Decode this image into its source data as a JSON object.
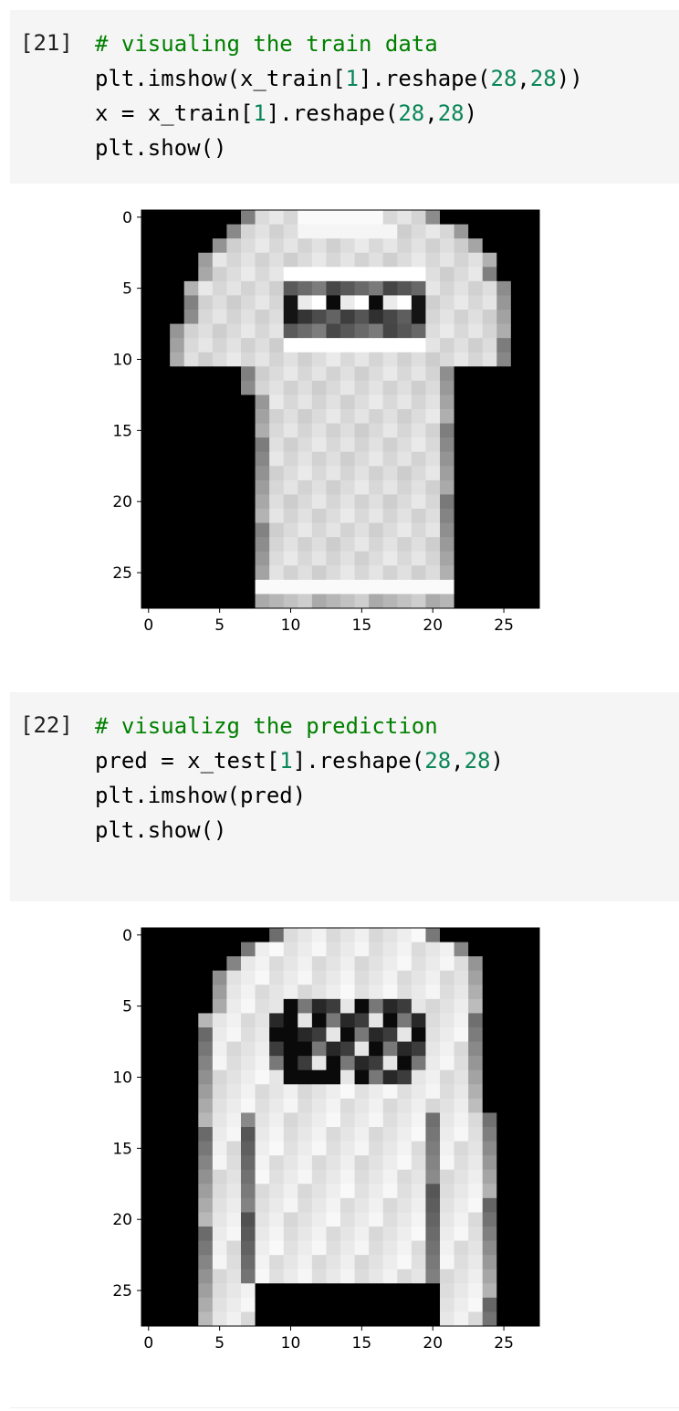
{
  "colors": {
    "cell_bg": "#f5f5f5",
    "comment": "#008000",
    "number": "#098658"
  },
  "cells": [
    {
      "exec_count": "[21]",
      "lines": [
        [
          {
            "t": "# visualing the train data",
            "c": "comment"
          }
        ],
        [
          {
            "t": "plt.imshow(x_train["
          },
          {
            "t": "1",
            "c": "num"
          },
          {
            "t": "].reshape("
          },
          {
            "t": "28",
            "c": "num"
          },
          {
            "t": ","
          },
          {
            "t": "28",
            "c": "num"
          },
          {
            "t": "))"
          }
        ],
        [
          {
            "t": "x = x_train["
          },
          {
            "t": "1",
            "c": "num"
          },
          {
            "t": "].reshape("
          },
          {
            "t": "28",
            "c": "num"
          },
          {
            "t": ","
          },
          {
            "t": "28",
            "c": "num"
          },
          {
            "t": ")"
          }
        ],
        [
          {
            "t": "plt.show()"
          }
        ]
      ]
    },
    {
      "exec_count": "[22]",
      "lines": [
        [
          {
            "t": "# visualizg the prediction",
            "c": "comment"
          }
        ],
        [
          {
            "t": "pred = x_test["
          },
          {
            "t": "1",
            "c": "num"
          },
          {
            "t": "].reshape("
          },
          {
            "t": "28",
            "c": "num"
          },
          {
            "t": ","
          },
          {
            "t": "28",
            "c": "num"
          },
          {
            "t": ")"
          }
        ],
        [
          {
            "t": "plt.imshow(pred)"
          }
        ],
        [
          {
            "t": "plt.show()"
          }
        ]
      ]
    }
  ],
  "chart_data": [
    {
      "type": "heatmap",
      "colormap": "gray",
      "rows": 28,
      "cols": 28,
      "xticks": [
        0,
        5,
        10,
        15,
        20,
        25
      ],
      "yticks": [
        0,
        5,
        10,
        15,
        20,
        25
      ],
      "description_shape": "tshirt",
      "shape_params": {
        "neck_rows": [
          0,
          1
        ],
        "neck_cols": [
          11,
          16
        ],
        "shoulder_rows": [
          0,
          2
        ],
        "sleeve_rows": [
          3,
          10
        ],
        "sleeve_outer": [
          3,
          25
        ],
        "body_cols": [
          8,
          21
        ],
        "body_rows": [
          3,
          27
        ],
        "print_rows": [
          5,
          8
        ],
        "print_cols": [
          10,
          19
        ]
      }
    },
    {
      "type": "heatmap",
      "colormap": "gray",
      "rows": 28,
      "cols": 28,
      "xticks": [
        0,
        5,
        10,
        15,
        20,
        25
      ],
      "yticks": [
        0,
        5,
        10,
        15,
        20,
        25
      ],
      "description_shape": "sweater",
      "shape_params": {
        "collar_rows": [
          0,
          2
        ],
        "collar_cols": [
          9,
          21
        ],
        "sleeve_left": [
          4,
          7
        ],
        "sleeve_right": [
          21,
          24
        ],
        "body_cols": [
          7,
          21
        ],
        "body_rows": [
          2,
          24
        ],
        "print_rows": [
          5,
          10
        ],
        "print_cols": [
          9,
          19
        ]
      }
    }
  ]
}
